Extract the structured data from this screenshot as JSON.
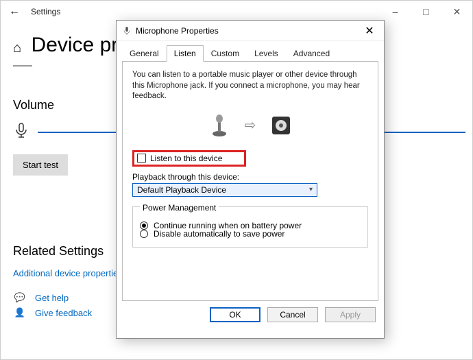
{
  "settings": {
    "window_title": "Settings",
    "page_title": "Device properties",
    "sections": {
      "volume_heading": "Volume",
      "start_test": "Start test",
      "related_heading": "Related Settings",
      "additional_link": "Additional device properties",
      "get_help": "Get help",
      "give_feedback": "Give feedback"
    }
  },
  "dialog": {
    "title": "Microphone Properties",
    "tabs": [
      "General",
      "Listen",
      "Custom",
      "Levels",
      "Advanced"
    ],
    "active_tab": "Listen",
    "description": "You can listen to a portable music player or other device through this Microphone jack.  If you connect a microphone, you may hear feedback.",
    "listen_checkbox": "Listen to this device",
    "playback_label": "Playback through this device:",
    "playback_value": "Default Playback Device",
    "power_legend": "Power Management",
    "power_opt1": "Continue running when on battery power",
    "power_opt2": "Disable automatically to save power",
    "buttons": {
      "ok": "OK",
      "cancel": "Cancel",
      "apply": "Apply"
    }
  }
}
